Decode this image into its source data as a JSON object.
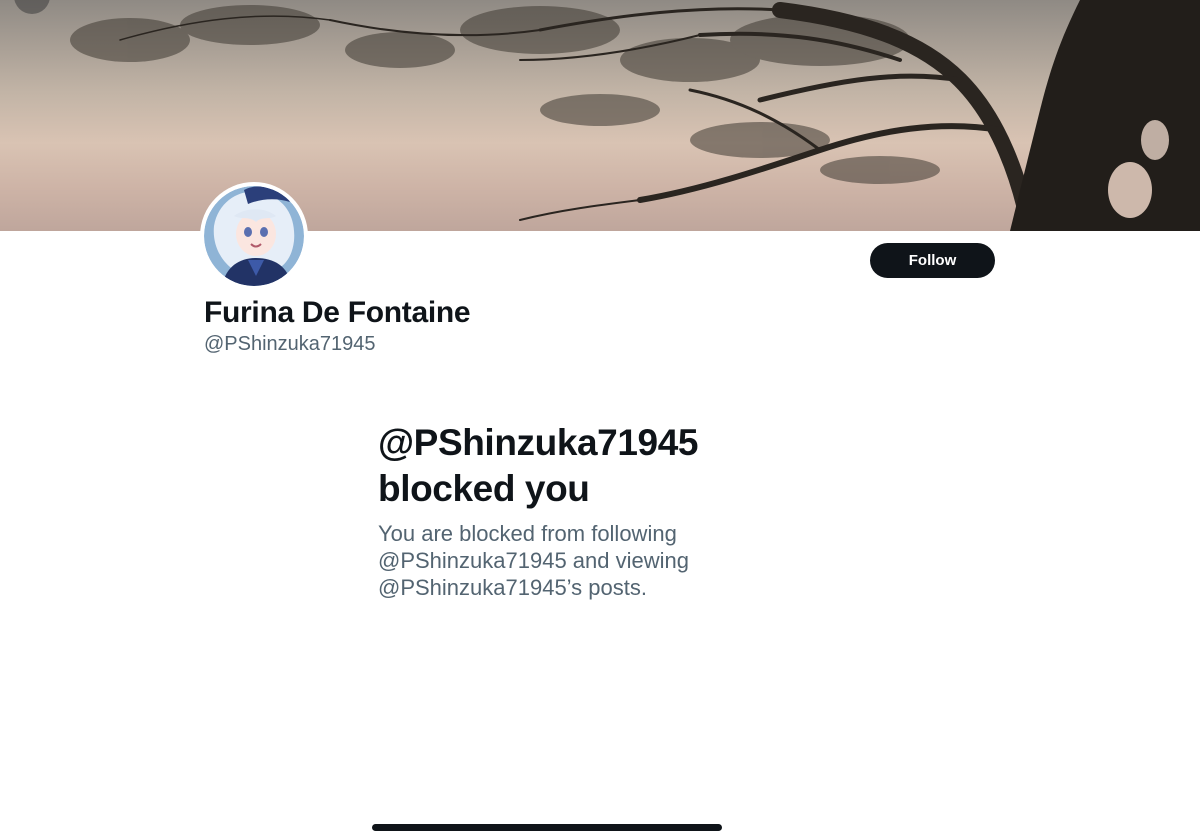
{
  "profile": {
    "display_name": "Furina De Fontaine",
    "handle": "@PShinzuka71945",
    "follow_label": "Follow"
  },
  "blocked": {
    "title_line1": "@PShinzuka71945",
    "title_line2": "blocked you",
    "desc_line1": "You are blocked from following",
    "desc_line2": "@PShinzuka71945 and viewing",
    "desc_line3": "@PShinzuka71945’s posts."
  },
  "icons": {
    "back": "back-arrow-icon",
    "avatar": "profile-avatar-image",
    "banner": "header-banner-image"
  },
  "colors": {
    "text_primary": "#0f1419",
    "text_secondary": "#536471",
    "button_bg": "#0f1419",
    "button_text": "#ffffff",
    "background": "#ffffff"
  }
}
